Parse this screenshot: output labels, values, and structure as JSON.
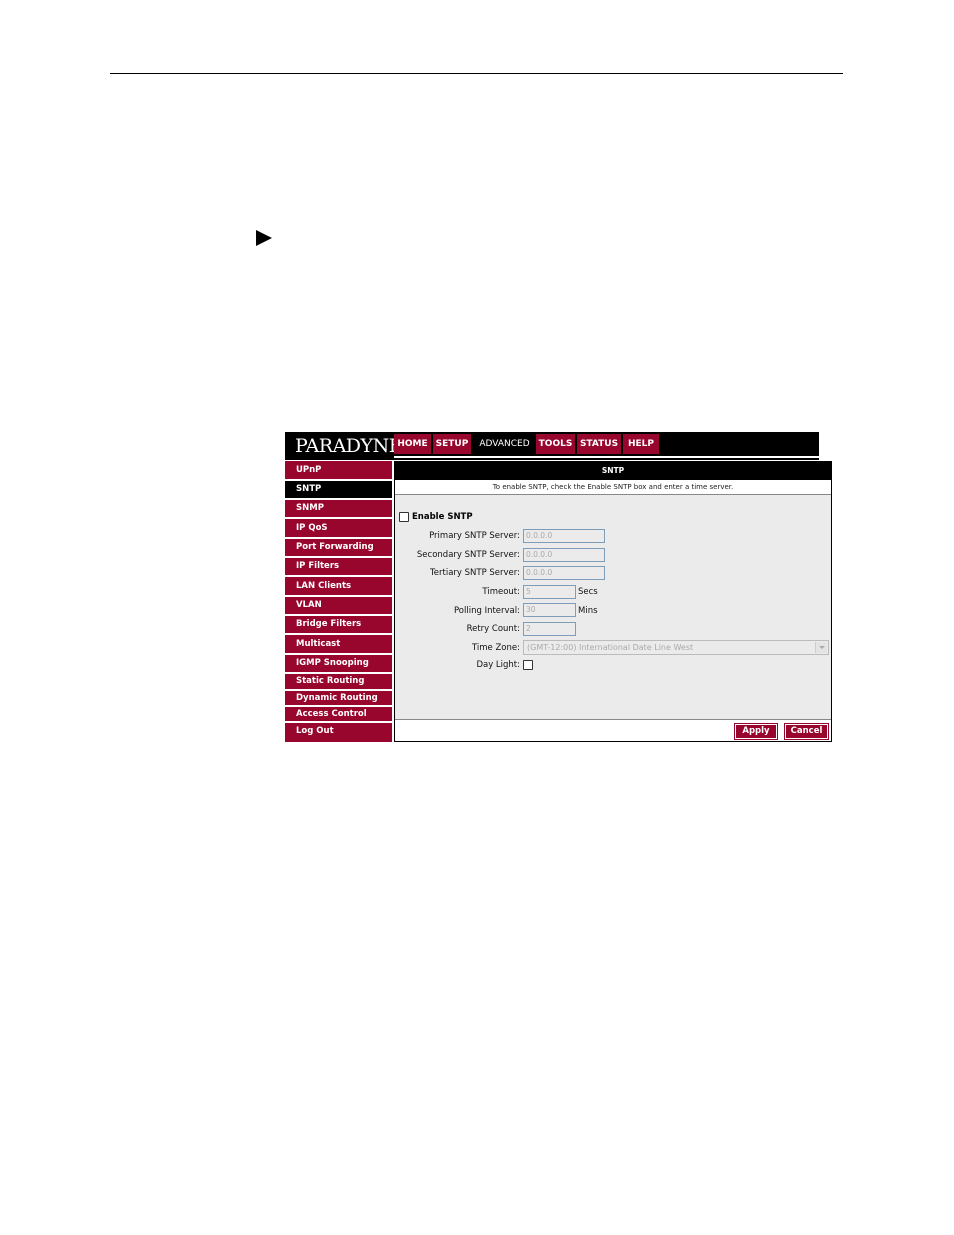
{
  "logo": "PARADYNE",
  "nav": [
    "HOME",
    "SETUP",
    "ADVANCED",
    "TOOLS",
    "STATUS",
    "HELP"
  ],
  "nav_active": "ADVANCED",
  "sidebar": [
    "UPnP",
    "SNTP",
    "SNMP",
    "IP QoS",
    "Port Forwarding",
    "IP Filters",
    "LAN Clients",
    "VLAN",
    "Bridge Filters",
    "Multicast",
    "IGMP Snooping",
    "Static Routing",
    "Dynamic Routing",
    "Access Control",
    "Log Out"
  ],
  "sidebar_active": "SNTP",
  "panel": {
    "title": "SNTP",
    "description": "To enable SNTP, check the Enable SNTP box and enter a time server."
  },
  "form": {
    "enable_label": "Enable SNTP",
    "primary_label": "Primary SNTP Server:",
    "primary_value": "0.0.0.0",
    "secondary_label": "Secondary SNTP Server:",
    "secondary_value": "0.0.0.0",
    "tertiary_label": "Tertiary SNTP Server:",
    "tertiary_value": "0.0.0.0",
    "timeout_label": "Timeout:",
    "timeout_value": "5",
    "timeout_unit": "Secs",
    "polling_label": "Polling Interval:",
    "polling_value": "30",
    "polling_unit": "Mins",
    "retry_label": "Retry Count:",
    "retry_value": "2",
    "timezone_label": "Time Zone:",
    "timezone_value": "(GMT-12:00) International Date Line West",
    "daylight_label": "Day Light:"
  },
  "buttons": {
    "apply": "Apply",
    "cancel": "Cancel"
  },
  "colors": {
    "brand": "#98052d",
    "bar": "#000000",
    "panel_bg": "#ebebeb"
  }
}
